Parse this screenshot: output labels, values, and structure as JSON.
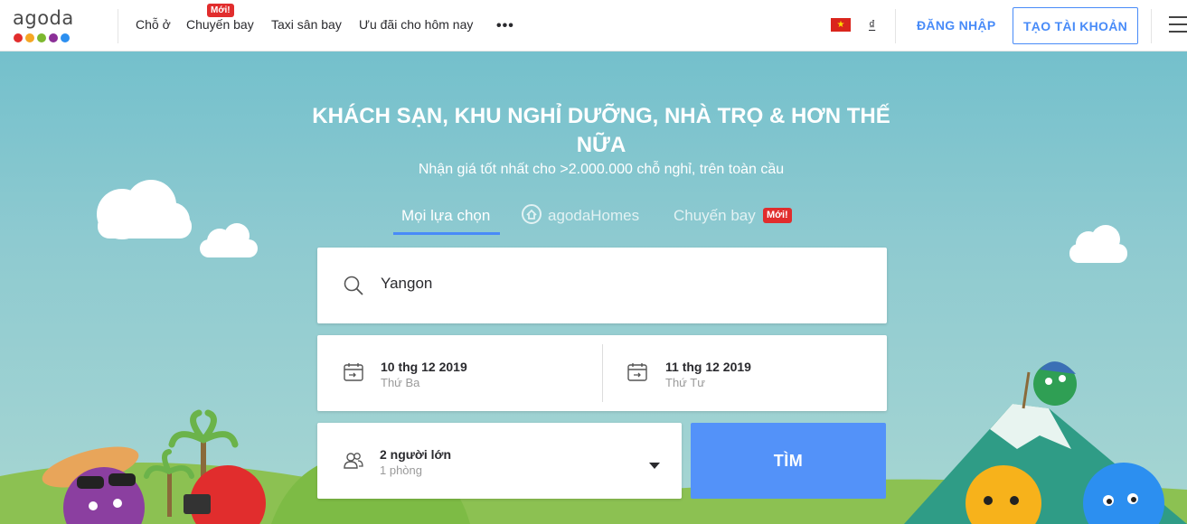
{
  "brand": {
    "logo_text": "agoda",
    "dot_colors": [
      "#e12d2d",
      "#f5a623",
      "#7cb82f",
      "#8b2f97",
      "#2c8ff0"
    ]
  },
  "nav": {
    "items": [
      {
        "label": "Chỗ ở"
      },
      {
        "label": "Chuyến bay",
        "badge": "Mới!"
      },
      {
        "label": "Taxi sân bay"
      },
      {
        "label": "Ưu đãi cho hôm nay"
      }
    ],
    "more_label": "•••",
    "currency_symbol": "₫",
    "flag_star": "★",
    "login_label": "ĐĂNG NHẬP",
    "signup_label": "TẠO TÀI KHOẢN"
  },
  "hero": {
    "title": "KHÁCH SẠN, KHU NGHỈ DƯỠNG, NHÀ TRỌ & HƠN THẾ NỮA",
    "subtitle": "Nhận giá tốt nhất cho >2.000.000 chỗ nghỉ, trên toàn cầu",
    "tabs": [
      {
        "label": "Mọi lựa chọn",
        "active": true
      },
      {
        "label": "agodaHomes",
        "active": false
      },
      {
        "label": "Chuyến bay",
        "active": false,
        "badge": "Mới!"
      }
    ]
  },
  "search": {
    "destination_value": "Yangon",
    "checkin": {
      "date": "10 thg 12 2019",
      "weekday": "Thứ Ba"
    },
    "checkout": {
      "date": "11 thg 12 2019",
      "weekday": "Thứ Tư"
    },
    "occupancy": {
      "guests": "2 người lớn",
      "rooms": "1 phòng"
    },
    "search_button_label": "TÌM"
  },
  "colors": {
    "accent": "#5392f9",
    "link": "#488bf8",
    "badge": "#e12d2d",
    "sky": "#8ecad0"
  }
}
